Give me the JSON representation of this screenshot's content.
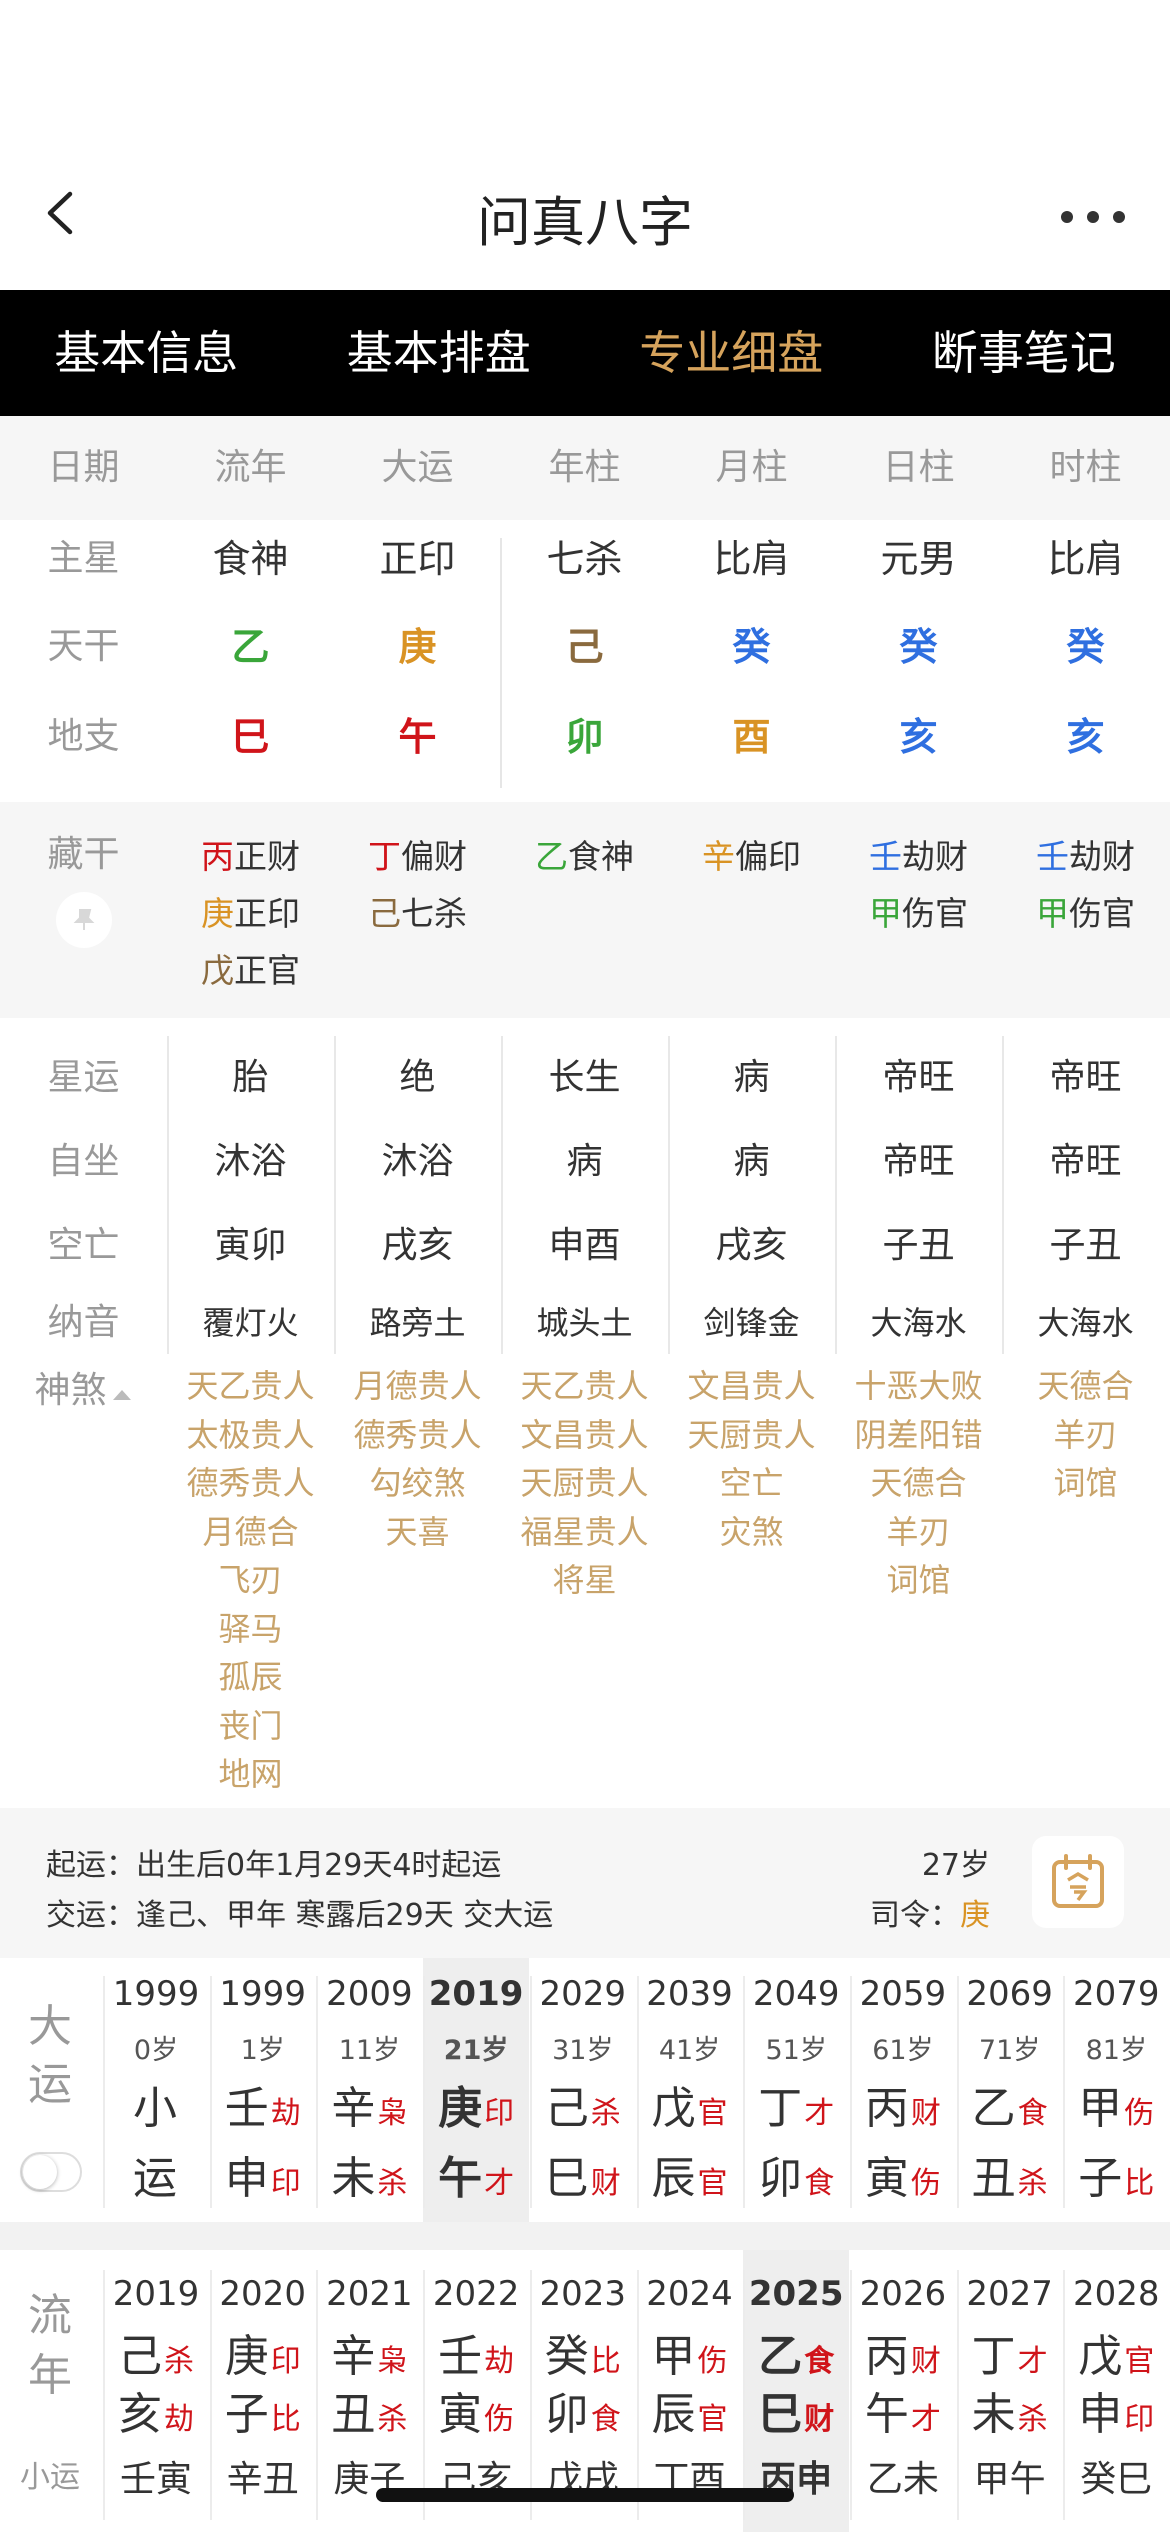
{
  "header": {
    "title": "问真八字"
  },
  "tabs": [
    {
      "label": "基本信息",
      "active": false
    },
    {
      "label": "基本排盘",
      "active": false
    },
    {
      "label": "专业细盘",
      "active": true
    },
    {
      "label": "断事笔记",
      "active": false
    }
  ],
  "columns": [
    "日期",
    "流年",
    "大运",
    "年柱",
    "月柱",
    "日柱",
    "时柱"
  ],
  "pillars": {
    "row_labels": {
      "main_star": "主星",
      "tiangan": "天干",
      "dizhi": "地支"
    },
    "main_star": [
      "食神",
      "正印",
      "七杀",
      "比肩",
      "元男",
      "比肩"
    ],
    "tiangan": [
      {
        "char": "乙",
        "color": "#3aa63a"
      },
      {
        "char": "庚",
        "color": "#d99324"
      },
      {
        "char": "己",
        "color": "#8a6a3e"
      },
      {
        "char": "癸",
        "color": "#2f6fe0"
      },
      {
        "char": "癸",
        "color": "#2f6fe0"
      },
      {
        "char": "癸",
        "color": "#2f6fe0"
      }
    ],
    "dizhi": [
      {
        "char": "巳",
        "color": "#d0141a"
      },
      {
        "char": "午",
        "color": "#d0141a"
      },
      {
        "char": "卯",
        "color": "#3aa63a"
      },
      {
        "char": "酉",
        "color": "#d99324"
      },
      {
        "char": "亥",
        "color": "#2f6fe0"
      },
      {
        "char": "亥",
        "color": "#2f6fe0"
      }
    ]
  },
  "canggan": {
    "label": "藏干",
    "cols": [
      [
        {
          "g": "丙",
          "c": "#d0141a",
          "s": "正财"
        },
        {
          "g": "庚",
          "c": "#d99324",
          "s": "正印"
        },
        {
          "g": "戊",
          "c": "#8a6a3e",
          "s": "正官"
        }
      ],
      [
        {
          "g": "丁",
          "c": "#d0141a",
          "s": "偏财"
        },
        {
          "g": "己",
          "c": "#8a6a3e",
          "s": "七杀"
        }
      ],
      [
        {
          "g": "乙",
          "c": "#3aa63a",
          "s": "食神"
        }
      ],
      [
        {
          "g": "辛",
          "c": "#d99324",
          "s": "偏印"
        }
      ],
      [
        {
          "g": "壬",
          "c": "#2f6fe0",
          "s": "劫财"
        },
        {
          "g": "甲",
          "c": "#3aa63a",
          "s": "伤官"
        }
      ],
      [
        {
          "g": "壬",
          "c": "#2f6fe0",
          "s": "劫财"
        },
        {
          "g": "甲",
          "c": "#3aa63a",
          "s": "伤官"
        }
      ]
    ]
  },
  "stars": {
    "labels": [
      "星运",
      "自坐",
      "空亡",
      "纳音"
    ],
    "xingyun": [
      "胎",
      "绝",
      "长生",
      "病",
      "帝旺",
      "帝旺"
    ],
    "zizuo": [
      "沐浴",
      "沐浴",
      "病",
      "病",
      "帝旺",
      "帝旺"
    ],
    "kongwang": [
      "寅卯",
      "戌亥",
      "申酉",
      "戌亥",
      "子丑",
      "子丑"
    ],
    "nayin": [
      "覆灯火",
      "路旁土",
      "城头土",
      "剑锋金",
      "大海水",
      "大海水"
    ]
  },
  "shensha": {
    "label": "神煞",
    "cols": [
      [
        "天乙贵人",
        "太极贵人",
        "德秀贵人",
        "月德合",
        "飞刃",
        "驿马",
        "孤辰",
        "丧门",
        "地网"
      ],
      [
        "月德贵人",
        "德秀贵人",
        "勾绞煞",
        "天喜"
      ],
      [
        "天乙贵人",
        "文昌贵人",
        "天厨贵人",
        "福星贵人",
        "将星"
      ],
      [
        "文昌贵人",
        "天厨贵人",
        "空亡",
        "灾煞"
      ],
      [
        "十恶大败",
        "阴差阳错",
        "天德合",
        "羊刃",
        "词馆"
      ],
      [
        "天德合",
        "羊刃",
        "词馆"
      ]
    ]
  },
  "qiyun": {
    "line1": "起运：出生后0年1月29天4时起运",
    "line2": "交运：逢己、甲年 寒露后29天 交大运",
    "age": "27岁",
    "siling_label": "司令：",
    "siling_value": "庚"
  },
  "dayun": {
    "label": [
      "大",
      "运"
    ],
    "cols": [
      {
        "year": "1999",
        "age": "0岁",
        "g": "小",
        "gs": "",
        "z": "运",
        "zs": "",
        "hl": false
      },
      {
        "year": "1999",
        "age": "1岁",
        "g": "壬",
        "gs": "劫",
        "z": "申",
        "zs": "印",
        "hl": false
      },
      {
        "year": "2009",
        "age": "11岁",
        "g": "辛",
        "gs": "枭",
        "z": "未",
        "zs": "杀",
        "hl": false
      },
      {
        "year": "2019",
        "age": "21岁",
        "g": "庚",
        "gs": "印",
        "z": "午",
        "zs": "才",
        "hl": true
      },
      {
        "year": "2029",
        "age": "31岁",
        "g": "己",
        "gs": "杀",
        "z": "巳",
        "zs": "财",
        "hl": false
      },
      {
        "year": "2039",
        "age": "41岁",
        "g": "戊",
        "gs": "官",
        "z": "辰",
        "zs": "官",
        "hl": false
      },
      {
        "year": "2049",
        "age": "51岁",
        "g": "丁",
        "gs": "才",
        "z": "卯",
        "zs": "食",
        "hl": false
      },
      {
        "year": "2059",
        "age": "61岁",
        "g": "丙",
        "gs": "财",
        "z": "寅",
        "zs": "伤",
        "hl": false
      },
      {
        "year": "2069",
        "age": "71岁",
        "g": "乙",
        "gs": "食",
        "z": "丑",
        "zs": "杀",
        "hl": false
      },
      {
        "year": "2079",
        "age": "81岁",
        "g": "甲",
        "gs": "伤",
        "z": "子",
        "zs": "比",
        "hl": false
      }
    ]
  },
  "liunian": {
    "label": [
      "流",
      "年"
    ],
    "sub_label": "小运",
    "cols": [
      {
        "year": "2019",
        "g": "己",
        "gs": "杀",
        "z": "亥",
        "zs": "劫",
        "xy": "壬寅",
        "hl": false
      },
      {
        "year": "2020",
        "g": "庚",
        "gs": "印",
        "z": "子",
        "zs": "比",
        "xy": "辛丑",
        "hl": false
      },
      {
        "year": "2021",
        "g": "辛",
        "gs": "枭",
        "z": "丑",
        "zs": "杀",
        "xy": "庚子",
        "hl": false
      },
      {
        "year": "2022",
        "g": "壬",
        "gs": "劫",
        "z": "寅",
        "zs": "伤",
        "xy": "己亥",
        "hl": false
      },
      {
        "year": "2023",
        "g": "癸",
        "gs": "比",
        "z": "卯",
        "zs": "食",
        "xy": "戊戌",
        "hl": false
      },
      {
        "year": "2024",
        "g": "甲",
        "gs": "伤",
        "z": "辰",
        "zs": "官",
        "xy": "丁酉",
        "hl": false
      },
      {
        "year": "2025",
        "g": "乙",
        "gs": "食",
        "z": "巳",
        "zs": "财",
        "xy": "丙申",
        "hl": true
      },
      {
        "year": "2026",
        "g": "丙",
        "gs": "财",
        "z": "午",
        "zs": "才",
        "xy": "乙未",
        "hl": false
      },
      {
        "year": "2027",
        "g": "丁",
        "gs": "才",
        "z": "未",
        "zs": "杀",
        "xy": "甲午",
        "hl": false
      },
      {
        "year": "2028",
        "g": "戊",
        "gs": "官",
        "z": "申",
        "zs": "印",
        "xy": "癸巳",
        "hl": false
      }
    ]
  },
  "colors": {
    "accent": "#d6a35c",
    "shensha": "#c8a36a",
    "shishen": "#d0141a"
  }
}
